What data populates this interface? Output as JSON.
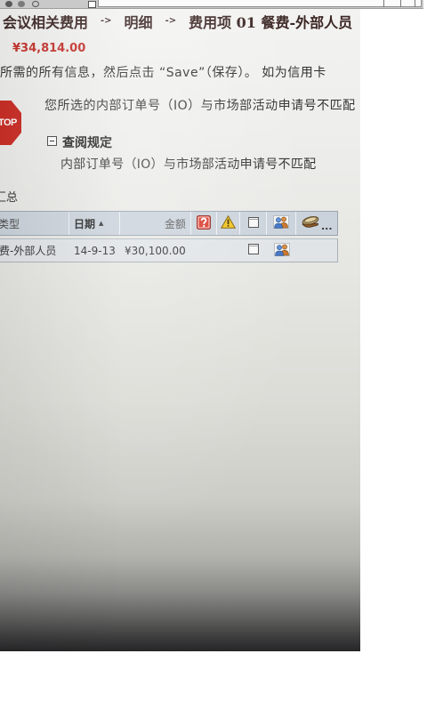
{
  "browser": {
    "toolbar_icons": [
      "back-icon",
      "forward-icon",
      "refresh-icon",
      "page-icon"
    ]
  },
  "breadcrumb": {
    "items": [
      "会议相关费用",
      "明细",
      "费用项 01 餐费-外部人员"
    ],
    "separator": "->"
  },
  "header": {
    "total_amount": "¥34,814.00"
  },
  "instruction": "所需的所有信息，然后点击 “Save”（保存）。 如为信用卡",
  "alert": {
    "icon": "stop-sign-icon",
    "stop_label": "STOP",
    "message": "您所选的内部订单号（IO）与市场部活动申请号不匹配",
    "policy_toggle_icon": "collapse-icon",
    "policy_title": "查阅规定",
    "policy_text": "内部订单号（IO）与市场部活动申请号不匹配"
  },
  "summary": {
    "title": "汇总",
    "columns": {
      "type": "类型",
      "date": "日期",
      "sort_indicator": "▲",
      "amount": "金额",
      "icons": [
        "question-icon",
        "warning-icon",
        "receipt-icon",
        "attendees-icon",
        "money-hand-icon"
      ],
      "more": "..."
    },
    "rows": [
      {
        "type": "费-外部人员",
        "date": "14-9-13",
        "amount": "¥30,100.00",
        "icons": [
          "receipt-icon",
          "attendees-icon"
        ]
      }
    ]
  },
  "colors": {
    "breadcrumb_text": "#3b2624",
    "amount_red": "#c4302a",
    "stop_red": "#c9281f",
    "table_header_bg": "#cad2db",
    "table_row_bg": "#e0e4e7",
    "page_background": "#ffffff"
  }
}
